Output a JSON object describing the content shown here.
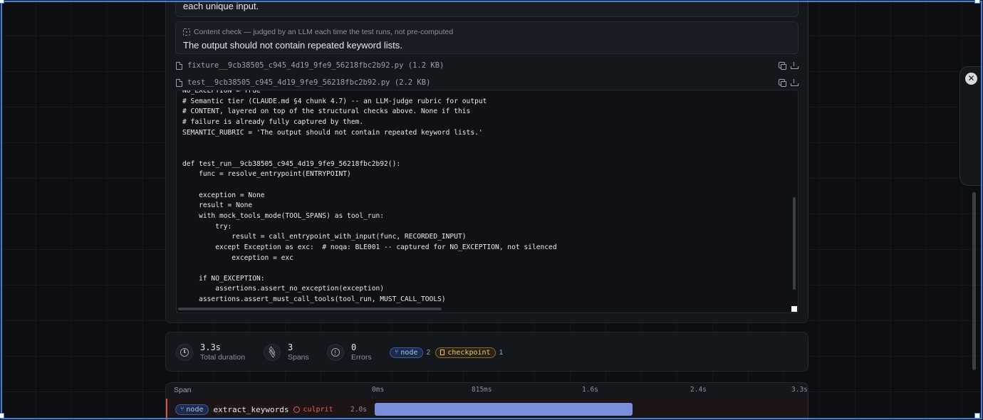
{
  "cards": {
    "description_tail": "each unique input.",
    "content_check_meta": "Content check — judged by an LLM each time the test runs, not pre-computed",
    "content_check_rubric": "The output should not contain repeated keyword lists."
  },
  "files": [
    {
      "name": "fixture__9cb38505_c945_4d19_9fe9_56218fbc2b92.py",
      "size": "(1.2 KB)"
    },
    {
      "name": "test__9cb38505_c945_4d19_9fe9_56218fbc2b92.py",
      "size": "(2.2 KB)"
    }
  ],
  "code": "NO_EXCEPTION = True\n# Semantic tier (CLAUDE.md §4 chunk 4.7) -- an LLM-judge rubric for output\n# CONTENT, layered on top of the structural checks above. None if this\n# failure is already fully captured by them.\nSEMANTIC_RUBRIC = 'The output should not contain repeated keyword lists.'\n\n\ndef test_run__9cb38505_c945_4d19_9fe9_56218fbc2b92():\n    func = resolve_entrypoint(ENTRYPOINT)\n\n    exception = None\n    result = None\n    with mock_tools_mode(TOOL_SPANS) as tool_run:\n        try:\n            result = call_entrypoint_with_input(func, RECORDED_INPUT)\n        except Exception as exc:  # noqa: BLE001 -- captured for NO_EXCEPTION, not silenced\n            exception = exc\n\n    if NO_EXCEPTION:\n        assertions.assert_no_exception(exception)\n    assertions.assert_must_call_tools(tool_run, MUST_CALL_TOOLS)",
  "stats": {
    "duration": {
      "value": "3.3s",
      "label": "Total duration"
    },
    "spans": {
      "value": "3",
      "label": "Spans"
    },
    "errors": {
      "value": "0",
      "label": "Errors"
    },
    "badges": [
      {
        "label": "node",
        "count": "2"
      },
      {
        "label": "checkpoint",
        "count": "1"
      }
    ]
  },
  "timeline": {
    "column_label": "Span",
    "ticks": [
      "0ms",
      "815ms",
      "1.6s",
      "2.4s",
      "3.3s"
    ],
    "total_ms": 3300,
    "rows": [
      {
        "kind": "node",
        "name": "extract_keywords",
        "flag": "culprit",
        "duration_label": "2.0s",
        "start_ms": 0,
        "duration_ms": 2030
      }
    ]
  },
  "drawer": {
    "close_glyph": "✕"
  }
}
